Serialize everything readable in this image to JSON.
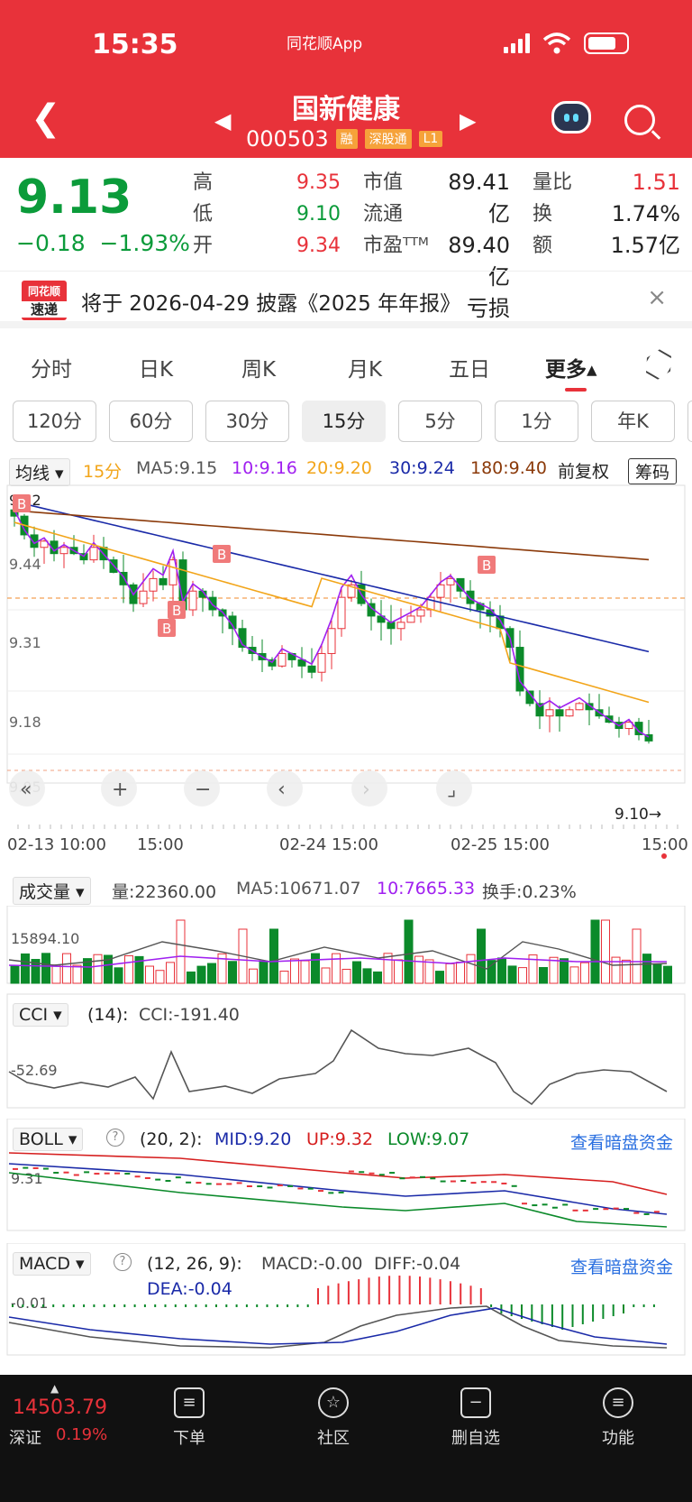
{
  "status": {
    "time": "15:35",
    "app": "同花顺App"
  },
  "header": {
    "title": "国新健康",
    "code": "000503",
    "badges": [
      "融",
      "深股通",
      "L1"
    ]
  },
  "quote": {
    "price": "9.13",
    "change": "−0.18",
    "change_pct": "−1.93%",
    "items": [
      {
        "l1": "高",
        "v1": "9.35",
        "l2": "市值",
        "v2": "89.41亿",
        "l3": "量比",
        "v3": "1.51"
      },
      {
        "l1": "低",
        "v1": "9.10",
        "l2": "流通",
        "v2": "89.40亿",
        "l3": "换",
        "v3": "1.74%"
      },
      {
        "l1": "开",
        "v1": "9.34",
        "l2": "市盈ᵀᵀᴹ",
        "v2": "亏损",
        "l3": "额",
        "v3": "1.57亿"
      }
    ]
  },
  "notice": {
    "logo_top": "同花顺",
    "logo_bottom": "速递",
    "text": "将于 2026-04-29 披露《2025 年年报》",
    "close": "×"
  },
  "tabs": [
    "分时",
    "日K",
    "周K",
    "月K",
    "五日",
    "更多▴"
  ],
  "periods": [
    "120分",
    "60分",
    "30分",
    "15分",
    "5分",
    "1分",
    "年K"
  ],
  "ma_bar": {
    "selector": "均线 ▾",
    "period": "15分",
    "ma5": "MA5:9.15",
    "ma10": "10:9.16",
    "ma20": "20:9.20",
    "ma30": "30:9.24",
    "ma180": "180:9.40",
    "adjust": "前复权",
    "chouma": "筹码"
  },
  "kline": {
    "y_labels": [
      "9.52",
      "9.44",
      "9.31",
      "9.18",
      "9.05"
    ],
    "x_labels": [
      "02-13 10:00",
      "15:00",
      "02-24 15:00",
      "02-25 15:00",
      "15:00"
    ],
    "last_label": "9.10→",
    "markers": [
      "B",
      "B",
      "B",
      "B",
      "B"
    ],
    "controls": [
      "«",
      "+",
      "−",
      "‹",
      "›",
      "⌟"
    ]
  },
  "volume": {
    "selector": "成交量 ▾",
    "vol": "量:22360.00",
    "ma5": "MA5:10671.07",
    "ma10": "10:7665.33",
    "turnover": "换手:0.23%",
    "y_label": "15894.10"
  },
  "cci": {
    "selector": "CCI ▾",
    "param": "(14):",
    "value": "CCI:-191.40",
    "y_label": "-52.69"
  },
  "boll": {
    "selector": "BOLL ▾",
    "help": "?",
    "param": "(20, 2):",
    "mid": "MID:9.20",
    "up": "UP:9.32",
    "low": "LOW:9.07",
    "link": "查看暗盘资金",
    "y_label": "9.31"
  },
  "macd": {
    "selector": "MACD ▾",
    "help": "?",
    "param": "(12, 26, 9):",
    "macd": "MACD:-0.00",
    "diff": "DIFF:-0.04",
    "dea": "DEA:-0.04",
    "link": "查看暗盘资金",
    "y_label": "-0.01"
  },
  "bottom": {
    "index_value": "14503.79",
    "index_name": "深证",
    "index_pct": "0.19%",
    "nav": [
      "下单",
      "社区",
      "删自选",
      "功能"
    ]
  }
}
